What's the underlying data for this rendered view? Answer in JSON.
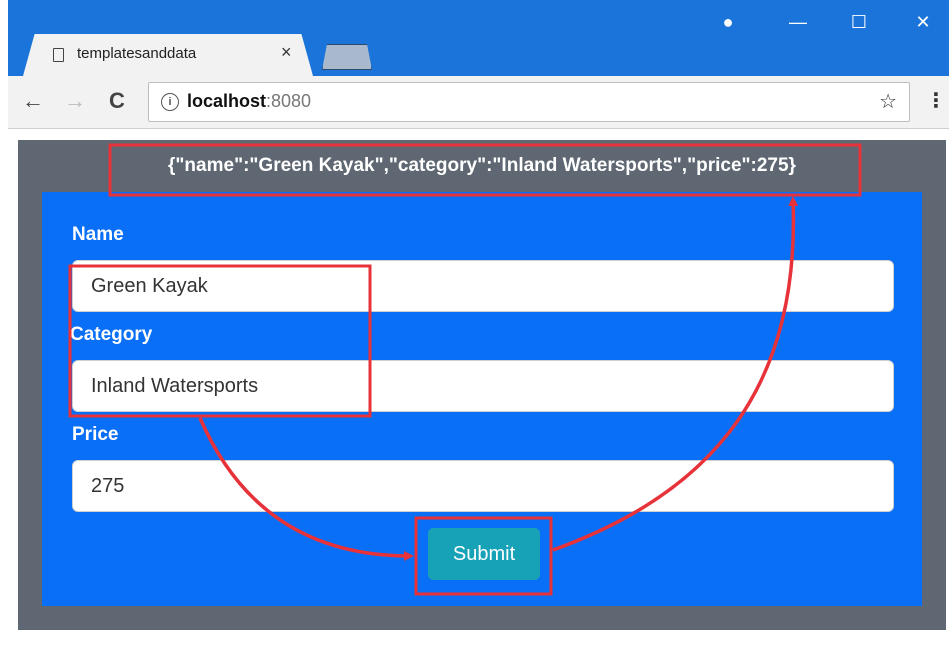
{
  "browser": {
    "tab_title": "templatesanddata",
    "tab_close": "×",
    "url_host": "localhost",
    "url_port": ":8080",
    "controls": {
      "profile": "●",
      "minimize": "—",
      "maximize": "☐",
      "close": "✕"
    },
    "nav": {
      "back": "←",
      "forward": "→",
      "reload": "C",
      "info": "i",
      "star": "☆",
      "menu": "⋮"
    }
  },
  "page": {
    "json_output": "{\"name\":\"Green Kayak\",\"category\":\"Inland Watersports\",\"price\":275}",
    "fields": [
      {
        "label": "Name",
        "value": "Green Kayak"
      },
      {
        "label": "Category",
        "value": "Inland Watersports"
      },
      {
        "label": "Price",
        "value": "275"
      }
    ],
    "submit_label": "Submit"
  },
  "colors": {
    "titlebar": "#1a74d9",
    "page_background": "#5f6872",
    "form_panel": "#0a6ff7",
    "submit_button": "#17a2b8",
    "annotation": "#e8323a"
  }
}
